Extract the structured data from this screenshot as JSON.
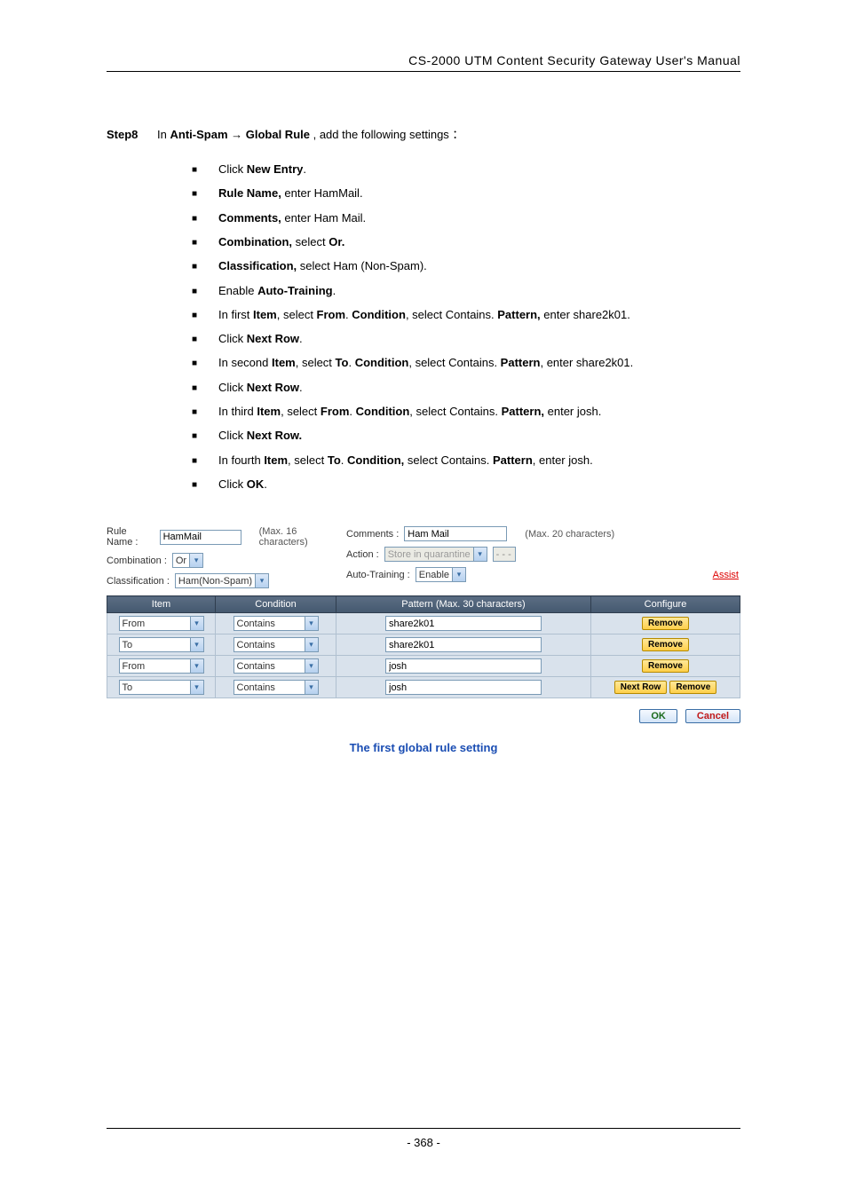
{
  "header": {
    "title": "CS-2000 UTM Content Security Gateway User's Manual"
  },
  "step": {
    "label": "Step8",
    "prefix": "In ",
    "path1": "Anti-Spam",
    "arrow": "→",
    "path2": "Global Rule",
    "suffix": " , add the following settings ：",
    "bullets": [
      {
        "pre": "Click ",
        "b1": "New Entry",
        "post": "."
      },
      {
        "b1": "Rule Name,",
        "mid": " enter HamMail."
      },
      {
        "b1": "Comments,",
        "mid": " enter Ham Mail."
      },
      {
        "b1": "Combination,",
        "mid": " select ",
        "b2": "Or."
      },
      {
        "b1": "Classification,",
        "mid": " select Ham (Non-Spam)."
      },
      {
        "pre": "Enable ",
        "b1": "Auto-Training",
        "post": "."
      },
      {
        "pre": "In first ",
        "b1": "Item",
        "mid": ", select ",
        "b2": "From",
        "mid2": ". ",
        "b3": "Condition",
        "mid3": ", select Contains. ",
        "b4": "Pattern,",
        "post": " enter share2k01."
      },
      {
        "pre": "Click ",
        "b1": "Next Row",
        "post": "."
      },
      {
        "pre": "In second ",
        "b1": "Item",
        "mid": ", select ",
        "b2": "To",
        "mid2": ". ",
        "b3": "Condition",
        "mid3": ", select Contains. ",
        "b4": "Pattern",
        "post": ", enter share2k01."
      },
      {
        "pre": "Click ",
        "b1": "Next Row",
        "post": "."
      },
      {
        "pre": "In third ",
        "b1": "Item",
        "mid": ", select ",
        "b2": "From",
        "mid2": ". ",
        "b3": "Condition",
        "mid3": ", select Contains. ",
        "b4": "Pattern,",
        "post": " enter josh."
      },
      {
        "pre": "Click ",
        "b1": "Next Row.",
        "post": ""
      },
      {
        "pre": "In fourth ",
        "b1": "Item",
        "mid": ", select ",
        "b2": "To",
        "mid2": ". ",
        "b3": "Condition,",
        "mid3": " select Contains. ",
        "b4": "Pattern",
        "post": ", enter josh."
      },
      {
        "pre": "Click ",
        "b1": "OK",
        "post": "."
      }
    ]
  },
  "form": {
    "ruleNameLabel": "Rule Name :",
    "ruleNameValue": "HamMail",
    "ruleNameHint": "(Max. 16 characters)",
    "commentsLabel": "Comments :",
    "commentsValue": "Ham Mail",
    "commentsHint": "(Max. 20 characters)",
    "combinationLabel": "Combination :",
    "combinationValue": "Or",
    "actionLabel": "Action :",
    "actionValue": "Store in quarantine",
    "actionExtra": "- - -",
    "classificationLabel": "Classification :",
    "classificationValue": "Ham(Non-Spam)",
    "autoTrainingLabel": "Auto-Training :",
    "autoTrainingValue": "Enable",
    "assist": "Assist"
  },
  "table": {
    "headers": {
      "item": "Item",
      "condition": "Condition",
      "pattern": "Pattern (Max. 30 characters)",
      "configure": "Configure"
    },
    "rows": [
      {
        "item": "From",
        "condition": "Contains",
        "pattern": "share2k01",
        "buttons": [
          "Remove"
        ]
      },
      {
        "item": "To",
        "condition": "Contains",
        "pattern": "share2k01",
        "buttons": [
          "Remove"
        ]
      },
      {
        "item": "From",
        "condition": "Contains",
        "pattern": "josh",
        "buttons": [
          "Remove"
        ]
      },
      {
        "item": "To",
        "condition": "Contains",
        "pattern": "josh",
        "buttons": [
          "Next Row",
          "Remove"
        ]
      }
    ]
  },
  "buttons": {
    "ok": "OK",
    "cancel": "Cancel"
  },
  "caption": "The first global rule setting",
  "footer": {
    "page": "- 368 -"
  }
}
